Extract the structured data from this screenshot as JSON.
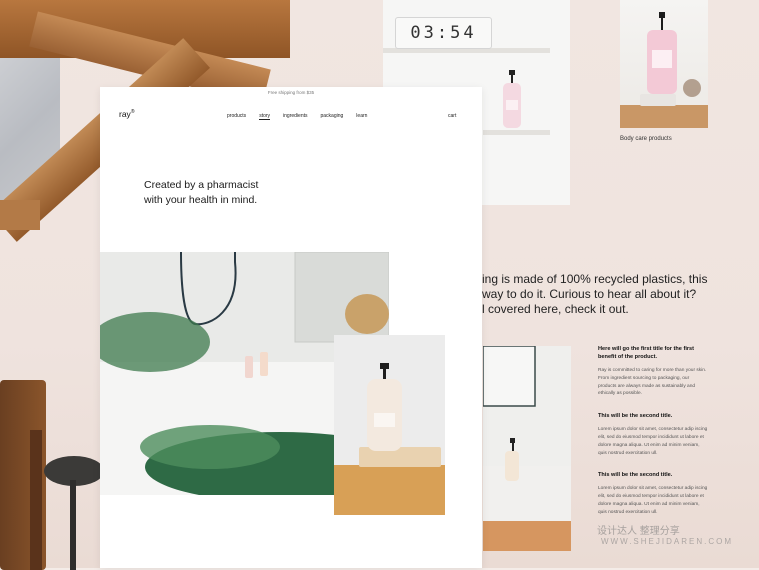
{
  "card": {
    "promo": "Free shipping from $35",
    "logo": "ray",
    "logo_mark": "®",
    "nav": [
      "products",
      "story",
      "ingredients",
      "packaging",
      "learn"
    ],
    "nav_active": "story",
    "cart": "cart",
    "hero_line1": "Created by a pharmacist",
    "hero_line2": "with your health in mind."
  },
  "clock": "03:54",
  "bodycare_label": "Body care products",
  "side_text": {
    "line1": "ing is made of 100% recycled plastics, this",
    "line2": "way to do it. Curious to hear all about it?",
    "line3": "l covered here, check it out."
  },
  "columns": [
    {
      "title": "Here will go the first title for the first benefit of the product.",
      "body": "Ray is committed to caring for more than your skin. From ingredient sourcing to packaging, our products are always made as sustainably and ethically as possible."
    },
    {
      "title": "This will be the second title.",
      "body": "Lorem ipsum dolor sit amet, consectetur adip iscing elit, sed do eiusmod tempor incididunt ut labore et dolore magna aliqua. Ut enim ad minim veniam, quis nostrud exercitation ull."
    },
    {
      "title": "This will be the second title.",
      "body": "Lorem ipsum dolor sit amet, consectetur adip iscing elit, sed do eiusmod tempor incididunt ut labore et dolore magna aliqua. Ut enim ad minim veniam, quis nostrud exercitation ull."
    }
  ],
  "watermark": {
    "line1": "设计达人 整理分享",
    "line2": "WWW.SHEJIDAREN.COM"
  },
  "colors": {
    "accent_wood": "#b8773f",
    "card_bg": "#ffffff",
    "text": "#1b1b1b"
  }
}
